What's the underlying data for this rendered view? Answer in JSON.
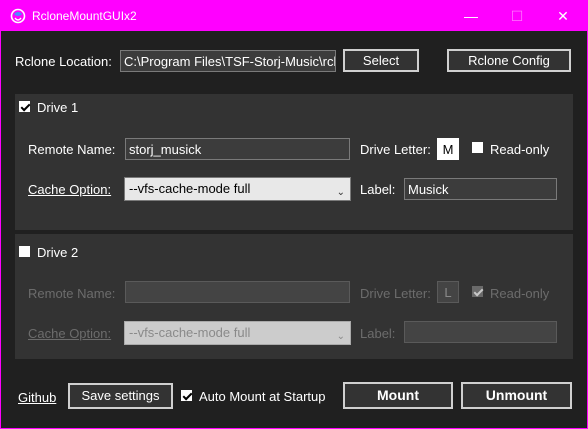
{
  "window": {
    "title": "RcloneMountGUIx2",
    "brand_color": "#ff00ff"
  },
  "top": {
    "rclone_location_label": "Rclone Location:",
    "rclone_location_value": "C:\\Program Files\\TSF-Storj-Music\\rcl",
    "select_label": "Select",
    "rclone_config_label": "Rclone Config"
  },
  "drive1": {
    "enabled": true,
    "title": "Drive 1",
    "remote_name_label": "Remote Name:",
    "remote_name_value": "storj_musick",
    "drive_letter_label": "Drive Letter:",
    "drive_letter_value": "M",
    "readonly_label": "Read-only",
    "readonly_checked": false,
    "cache_option_label": "Cache Option:",
    "cache_option_value": "--vfs-cache-mode full",
    "label_label": "Label:",
    "label_value": "Musick"
  },
  "drive2": {
    "enabled": false,
    "title": "Drive 2",
    "remote_name_label": "Remote Name:",
    "remote_name_value": "",
    "drive_letter_label": "Drive Letter:",
    "drive_letter_value": "L",
    "readonly_label": "Read-only",
    "readonly_checked": true,
    "cache_option_label": "Cache Option:",
    "cache_option_value": "--vfs-cache-mode full",
    "label_label": "Label:",
    "label_value": ""
  },
  "bottom": {
    "github_label": "Github",
    "save_settings_label": "Save settings",
    "auto_mount_label": "Auto Mount at Startup",
    "auto_mount_checked": true,
    "mount_label": "Mount",
    "unmount_label": "Unmount"
  }
}
